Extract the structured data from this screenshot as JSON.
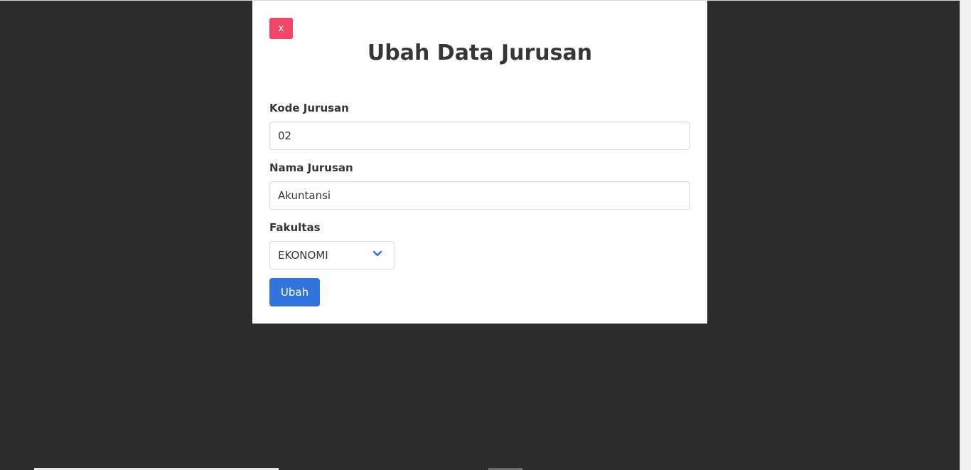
{
  "modal": {
    "close_label": "x",
    "title": "Ubah Data Jurusan",
    "fields": {
      "kode": {
        "label": "Kode Jurusan",
        "value": "02"
      },
      "nama": {
        "label": "Nama Jurusan",
        "value": "Akuntansi"
      },
      "fakultas": {
        "label": "Fakultas",
        "selected": "EKONOMI"
      }
    },
    "submit_label": "Ubah"
  },
  "colors": {
    "backdrop": "#2c2c2c",
    "close_button": "#f14668",
    "submit_button": "#3273dc",
    "chevron": "#3273dc"
  },
  "icons": {
    "select_arrow": "chevron-down-icon"
  }
}
